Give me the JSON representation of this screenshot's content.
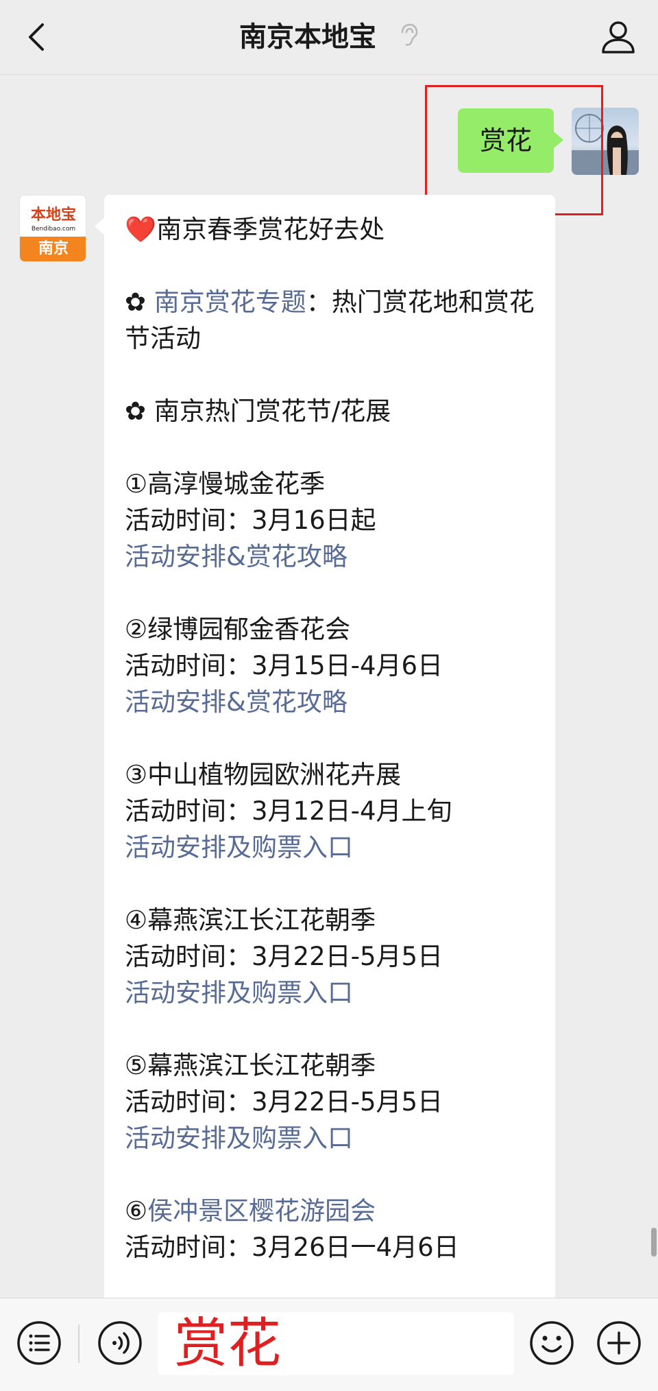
{
  "header": {
    "title": "南京本地宝"
  },
  "chat": {
    "user_message": "赏花",
    "bot_avatar": {
      "logo_text": "本地宝",
      "logo_url": "Bendibao.com",
      "city": "南京"
    },
    "bot_message": {
      "heading_heart": "❤️",
      "heading": "南京春季赏花好去处",
      "bullet": "✿",
      "topic_link": "南京赏花专题",
      "topic_suffix": "：热门赏花地和赏花节活动",
      "section_title": "南京热门赏花节/花展",
      "time_label": "活动时间：",
      "events": [
        {
          "num": "①",
          "name": "高淳慢城金花季",
          "time": "3月16日起",
          "link": "活动安排&赏花攻略"
        },
        {
          "num": "②",
          "name": "绿博园郁金香花会",
          "time": "3月15日-4月6日",
          "link": "活动安排&赏花攻略"
        },
        {
          "num": "③",
          "name": "中山植物园欧洲花卉展",
          "time": "3月12日-4月上旬",
          "link": "活动安排及购票入口"
        },
        {
          "num": "④",
          "name": "幕燕滨江长江花朝季",
          "time": "3月22日-5月5日",
          "link": "活动安排及购票入口"
        },
        {
          "num": "⑤",
          "name": "幕燕滨江长江花朝季",
          "time": "3月22日-5月5日",
          "link": "活动安排及购票入口"
        },
        {
          "num": "⑥",
          "name": "侯冲景区樱花游园会",
          "time": "3月26日一4月6日"
        }
      ]
    }
  },
  "input": {
    "value": "赏花"
  },
  "colors": {
    "bubble_green": "#95ec69",
    "link_blue": "#576b95",
    "highlight_red": "#e02020"
  },
  "icons": [
    "back-icon",
    "ear-icon",
    "person-icon",
    "menu-list-icon",
    "voice-icon",
    "emoji-icon",
    "plus-icon"
  ]
}
